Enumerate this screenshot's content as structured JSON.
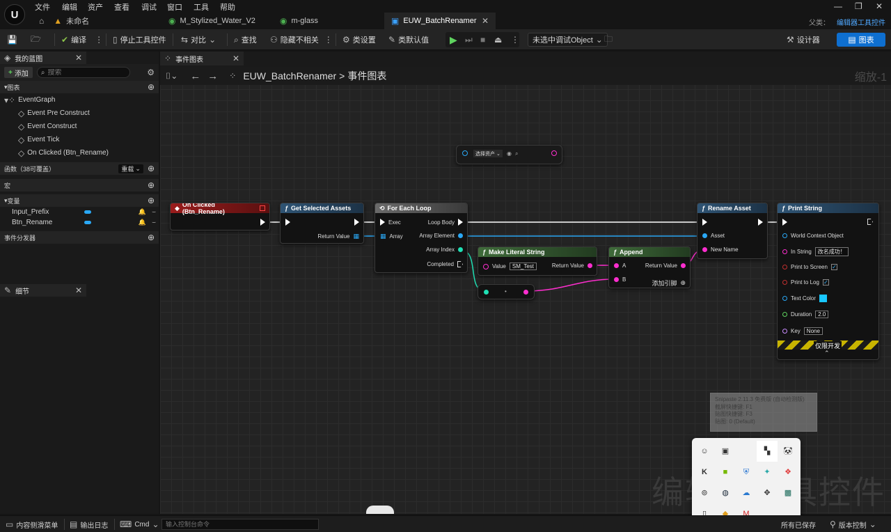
{
  "menu": [
    "文件",
    "编辑",
    "资产",
    "查看",
    "调试",
    "窗口",
    "工具",
    "帮助"
  ],
  "tabs": [
    {
      "label": "未命名",
      "icon": "home-icon"
    },
    {
      "label": "M_Stylized_Water_V2"
    },
    {
      "label": "m-glass"
    },
    {
      "label": "EUW_BatchRenamer"
    }
  ],
  "parent": {
    "label": "父类：",
    "value": "编辑器工具控件"
  },
  "toolbar": {
    "compile": "编译",
    "stop_widget": "停止工具控件",
    "diff": "对比",
    "find": "查找",
    "hide_unrelated": "隐藏不相关",
    "class_settings": "类设置",
    "class_defaults": "类默认值",
    "debug_object": "未选中调试Object",
    "designer": "设计器",
    "graph": "图表"
  },
  "left_panel": {
    "title": "我的蓝图",
    "add": "添加",
    "search_placeholder": "搜索",
    "graphs_label": "图表",
    "event_graph": "EventGraph",
    "events": [
      "Event Pre Construct",
      "Event Construct",
      "Event Tick",
      "On Clicked (Btn_Rename)"
    ],
    "functions_label": "函数（38可覆盖）",
    "override": "重载",
    "macros_label": "宏",
    "variables_label": "变量",
    "variables": [
      "Input_Prefix",
      "Btn_Rename"
    ],
    "dispatchers_label": "事件分发器"
  },
  "details_panel": {
    "title": "细节"
  },
  "graph_tab": {
    "label": "事件图表"
  },
  "breadcrumb": {
    "root": "EUW_BatchRenamer",
    "sep": ">",
    "leaf": "事件图表"
  },
  "zoom": "缩放-1",
  "watermark": "编辑器工具控件",
  "nodes": {
    "select_asset": {
      "label": "选择资产"
    },
    "on_clicked": {
      "title": "On Clicked (Btn_Rename)"
    },
    "get_selected": {
      "title": "Get Selected Assets",
      "return": "Return Value"
    },
    "for_each": {
      "title": "For Each Loop",
      "exec": "Exec",
      "array": "Array",
      "loop_body": "Loop Body",
      "array_element": "Array Element",
      "array_index": "Array Index",
      "completed": "Completed"
    },
    "make_literal": {
      "title": "Make Literal String",
      "value_label": "Value",
      "value": "SM_Test",
      "return": "Return Value"
    },
    "append": {
      "title": "Append",
      "a": "A",
      "b": "B",
      "return": "Return Value",
      "add_pin": "添加引脚"
    },
    "rename_asset": {
      "title": "Rename Asset",
      "asset": "Asset",
      "new_name": "New Name"
    },
    "print_string": {
      "title": "Print String",
      "world": "World Context Object",
      "in_string": "In String",
      "in_string_value": "改名成功！",
      "print_screen": "Print to Screen",
      "print_log": "Print to Log",
      "text_color": "Text Color",
      "duration": "Duration",
      "duration_value": "2.0",
      "key": "Key",
      "key_value": "None",
      "dev_only": "仅限开发"
    }
  },
  "tooltip": [
    "Snipaste 2.11.3 免费版 (自动检测版)",
    "截屏快捷键: F1",
    "贴图快捷键: F3",
    "贴图: 0 (Default)"
  ],
  "bottom": {
    "content_drawer": "内容侧滑菜单",
    "output_log": "输出日志",
    "cmd": "Cmd",
    "console_placeholder": "输入控制台命令",
    "saved": "所有已保存",
    "source_control": "版本控制"
  },
  "colors": {
    "accent": "#0e6fd0",
    "exec": "#ffffff",
    "object": "#2aa8f5",
    "string": "#ff2ecf",
    "int": "#1fe0b4",
    "bool": "#8b0000",
    "event": "#8a1616",
    "func": "#2e4b66",
    "pure": "#3b5c38"
  }
}
